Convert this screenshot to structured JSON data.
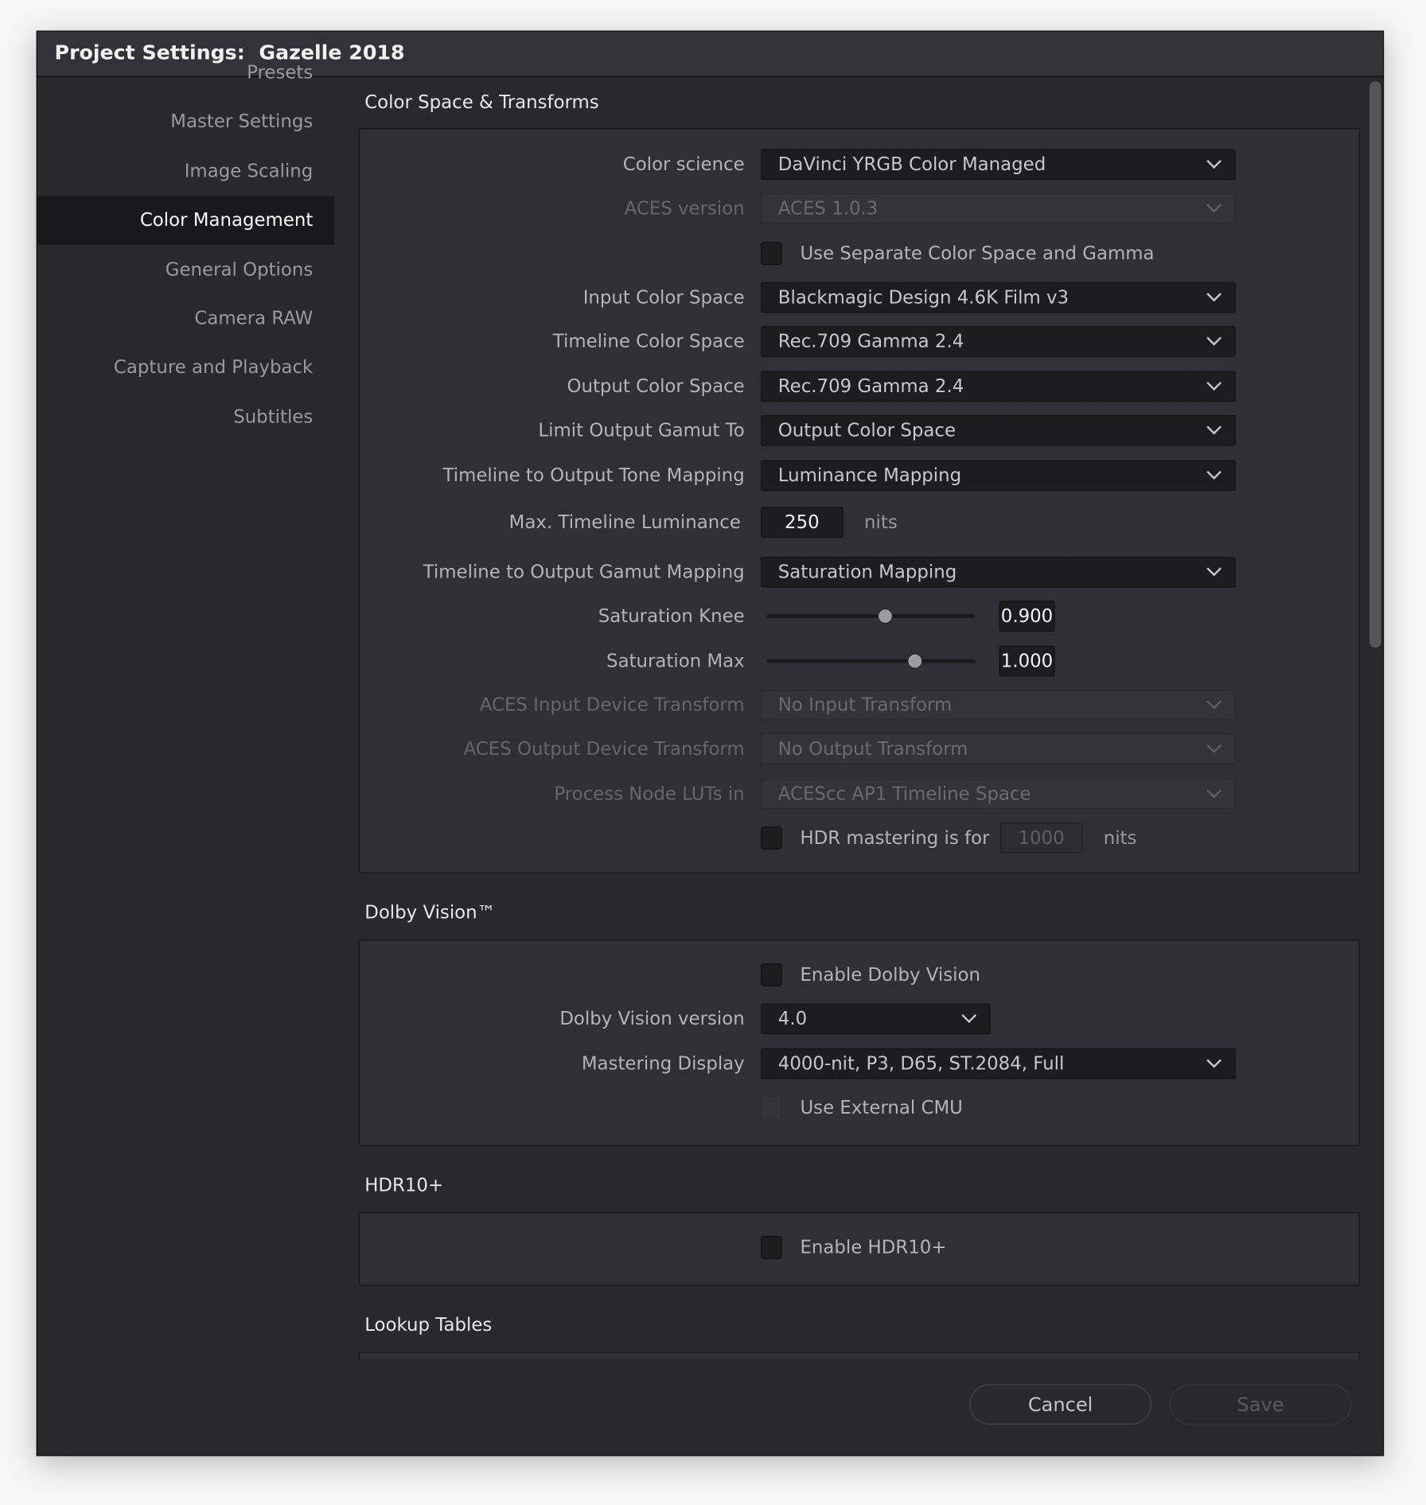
{
  "window": {
    "title": "Project Settings:  Gazelle 2018"
  },
  "sidebar": {
    "items": [
      {
        "label": "Presets",
        "selected": false
      },
      {
        "label": "Master Settings",
        "selected": false
      },
      {
        "label": "Image Scaling",
        "selected": false
      },
      {
        "label": "Color Management",
        "selected": true
      },
      {
        "label": "General Options",
        "selected": false
      },
      {
        "label": "Camera RAW",
        "selected": false
      },
      {
        "label": "Capture and Playback",
        "selected": false
      },
      {
        "label": "Subtitles",
        "selected": false
      }
    ]
  },
  "sections": {
    "color_space": {
      "title": "Color Space & Transforms",
      "rows": [
        {
          "type": "dropdown",
          "label": "Color science",
          "value": "DaVinci YRGB Color Managed",
          "disabled": false
        },
        {
          "type": "dropdown",
          "label": "ACES version",
          "value": "ACES 1.0.3",
          "disabled": true
        },
        {
          "type": "checkbox",
          "label": "Use Separate Color Space and Gamma",
          "checked": false,
          "disabled": false
        },
        {
          "type": "dropdown",
          "label": "Input Color Space",
          "value": "Blackmagic Design 4.6K Film v3",
          "disabled": false
        },
        {
          "type": "dropdown",
          "label": "Timeline Color Space",
          "value": "Rec.709 Gamma 2.4",
          "disabled": false
        },
        {
          "type": "dropdown",
          "label": "Output Color Space",
          "value": "Rec.709 Gamma 2.4",
          "disabled": false
        },
        {
          "type": "dropdown",
          "label": "Limit Output Gamut To",
          "value": "Output Color Space",
          "disabled": false
        },
        {
          "type": "dropdown",
          "label": "Timeline to Output Tone Mapping",
          "value": "Luminance Mapping",
          "disabled": false
        },
        {
          "type": "number",
          "label": "Max. Timeline Luminance",
          "value": "250",
          "unit": "nits",
          "disabled": false
        },
        {
          "type": "dropdown",
          "label": "Timeline to Output Gamut Mapping",
          "value": "Saturation Mapping",
          "disabled": false
        },
        {
          "type": "slider",
          "label": "Saturation Knee",
          "value": "0.900",
          "position": 0.57
        },
        {
          "type": "slider",
          "label": "Saturation Max",
          "value": "1.000",
          "position": 0.71
        },
        {
          "type": "dropdown",
          "label": "ACES Input Device Transform",
          "value": "No Input Transform",
          "disabled": true
        },
        {
          "type": "dropdown",
          "label": "ACES Output Device Transform",
          "value": "No Output Transform",
          "disabled": true
        },
        {
          "type": "dropdown",
          "label": "Process Node LUTs in",
          "value": "ACEScc AP1 Timeline Space",
          "disabled": true
        },
        {
          "type": "checkbox_number",
          "label": "HDR mastering is for",
          "value": "1000",
          "unit": "nits",
          "checked": false,
          "disabled": false
        }
      ]
    },
    "dolby": {
      "title": "Dolby Vision™",
      "rows": [
        {
          "type": "checkbox",
          "label": "Enable Dolby Vision",
          "checked": false,
          "disabled": false
        },
        {
          "type": "dropdown_short",
          "label": "Dolby Vision version",
          "value": "4.0",
          "disabled": false
        },
        {
          "type": "dropdown",
          "label": "Mastering Display",
          "value": "4000-nit, P3, D65, ST.2084, Full",
          "disabled": false
        },
        {
          "type": "checkbox",
          "label": "Use External CMU",
          "checked": false,
          "disabled": true
        }
      ]
    },
    "hdr10": {
      "title": "HDR10+",
      "rows": [
        {
          "type": "checkbox",
          "label": "Enable HDR10+",
          "checked": false,
          "disabled": false
        }
      ]
    },
    "luts": {
      "title": "Lookup Tables"
    }
  },
  "footer": {
    "cancel_label": "Cancel",
    "save_label": "Save",
    "save_disabled": true
  }
}
